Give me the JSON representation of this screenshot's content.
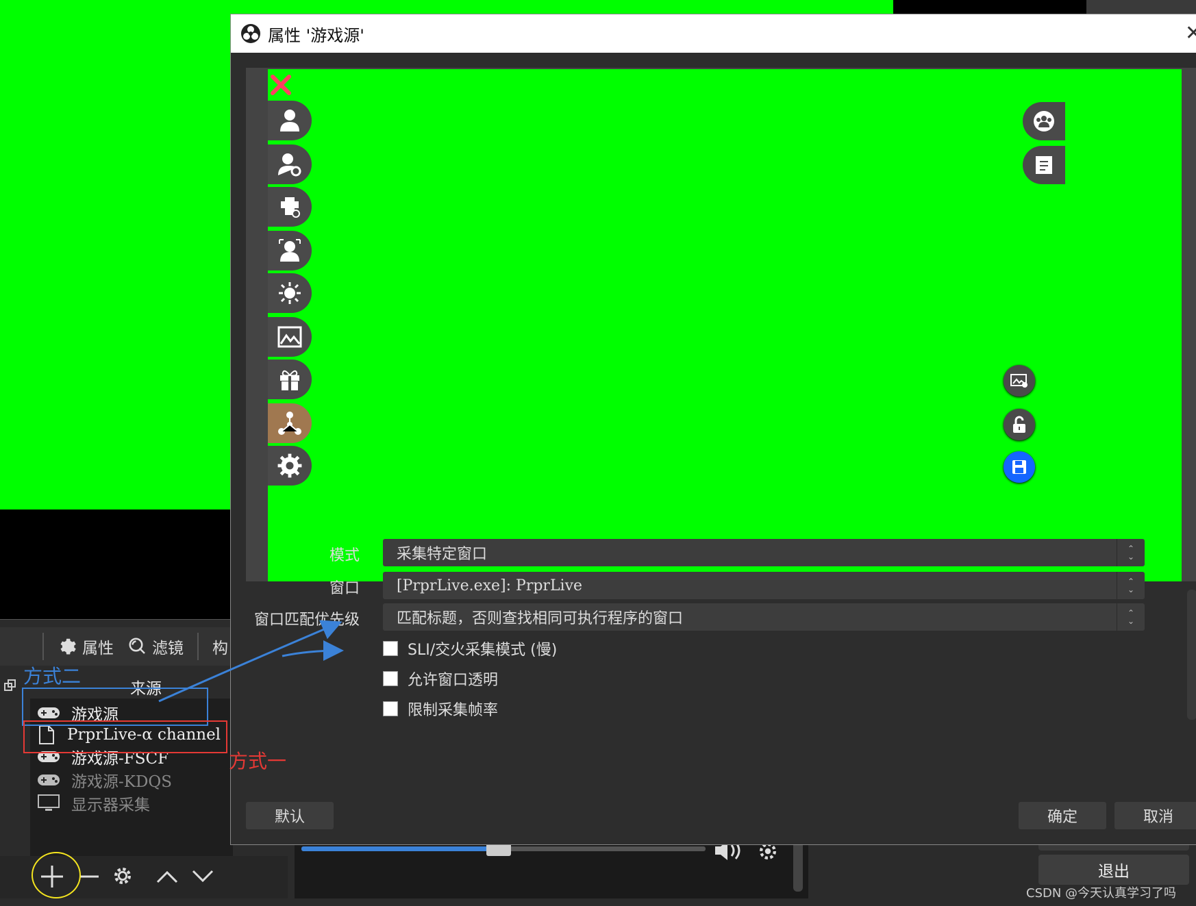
{
  "dialog": {
    "title": "属性 '游戏源'",
    "fields": {
      "mode": {
        "label": "模式",
        "value": "采集特定窗口"
      },
      "window": {
        "label": "窗口",
        "value": "[PrprLive.exe]: PrprLive"
      },
      "priority": {
        "label": "窗口匹配优先级",
        "value": "匹配标题，否则查找相同可执行程序的窗口"
      }
    },
    "checkboxes": [
      {
        "label": "SLI/交火采集模式 (慢)",
        "checked": false
      },
      {
        "label": "允许窗口透明",
        "checked": false
      },
      {
        "label": "限制采集帧率",
        "checked": false
      }
    ],
    "buttons": {
      "default": "默认",
      "ok": "确定",
      "cancel": "取消"
    }
  },
  "main": {
    "toolbar": {
      "properties": "属性",
      "filters": "滤镜",
      "more": "构"
    },
    "sources_title": "来源",
    "sources": [
      {
        "label": "游戏源",
        "icon": "gamepad-icon",
        "dim": false
      },
      {
        "label": "PrprLive-α channel",
        "icon": "file-icon",
        "dim": false
      },
      {
        "label": "游戏源-FSCF",
        "icon": "gamepad-icon",
        "dim": false
      },
      {
        "label": "游戏源-KDQS",
        "icon": "gamepad-icon",
        "dim": true
      },
      {
        "label": "显示器采集",
        "icon": "monitor-icon",
        "dim": true
      }
    ],
    "exit_label": "退出"
  },
  "annotations": {
    "mode_two": "方式二",
    "mode_one": "方式一"
  },
  "watermark": "CSDN @今天认真学习了吗",
  "colors": {
    "preview_green": "#00ff00",
    "annotation_blue": "#3b82d8",
    "annotation_red": "#e53935",
    "annotation_yellow": "#f5e51f",
    "save_blue": "#1565ff"
  }
}
